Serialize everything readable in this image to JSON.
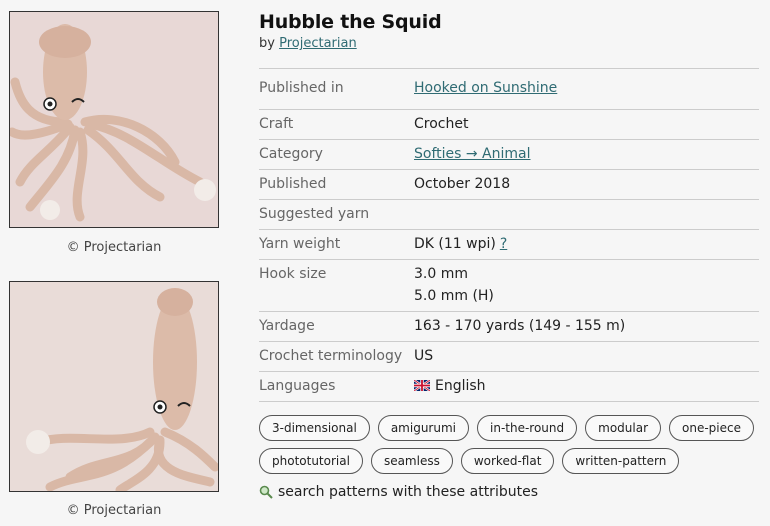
{
  "pattern": {
    "title": "Hubble the Squid",
    "by_label": "by",
    "designer": "Projectarian"
  },
  "photos": [
    {
      "credit": "© Projectarian"
    },
    {
      "credit": "© Projectarian"
    }
  ],
  "details": {
    "published_in": {
      "label": "Published in",
      "value": "Hooked on Sunshine"
    },
    "craft": {
      "label": "Craft",
      "value": "Crochet"
    },
    "category": {
      "label": "Category",
      "value": "Softies → Animal"
    },
    "published": {
      "label": "Published",
      "value": "October 2018"
    },
    "suggested_yarn": {
      "label": "Suggested yarn",
      "value": ""
    },
    "yarn_weight": {
      "label": "Yarn weight",
      "value": "DK (11 wpi)",
      "help": "?"
    },
    "hook_size": {
      "label": "Hook size",
      "value1": "3.0 mm",
      "value2": "5.0 mm (H)"
    },
    "yardage": {
      "label": "Yardage",
      "value": "163 - 170 yards (149 - 155 m)"
    },
    "terminology": {
      "label": "Crochet terminology",
      "value": "US"
    },
    "languages": {
      "label": "Languages",
      "value": "English",
      "flag_icon": "uk-flag-icon"
    }
  },
  "attributes": [
    "3-dimensional",
    "amigurumi",
    "in-the-round",
    "modular",
    "one-piece",
    "phototutorial",
    "seamless",
    "worked-flat",
    "written-pattern"
  ],
  "search_link": {
    "label": "search patterns with these attributes",
    "icon": "magnifier-icon"
  },
  "colors": {
    "link": "#2f6b73",
    "background": "#f6f6f6"
  }
}
